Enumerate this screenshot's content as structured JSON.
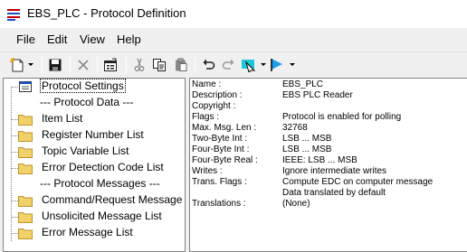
{
  "window": {
    "title": "EBS_PLC - Protocol Definition"
  },
  "menu": [
    "File",
    "Edit",
    "View",
    "Help"
  ],
  "toolbar": {
    "buttons": [
      "new-icon",
      "save-icon",
      "delete-icon",
      "properties-icon",
      "cut-icon",
      "copy-icon",
      "paste-icon",
      "undo-icon",
      "redo-icon",
      "select-icon",
      "flag-icon"
    ]
  },
  "tree": {
    "items": [
      {
        "label": "Protocol Settings",
        "type": "settings",
        "selected": true
      },
      {
        "label": "--- Protocol Data ---",
        "type": "header"
      },
      {
        "label": "Item List",
        "type": "folder"
      },
      {
        "label": "Register Number List",
        "type": "folder"
      },
      {
        "label": "Topic Variable List",
        "type": "folder"
      },
      {
        "label": "Error Detection Code List",
        "type": "folder"
      },
      {
        "label": "--- Protocol Messages ---",
        "type": "header"
      },
      {
        "label": "Command/Request Message",
        "type": "folder"
      },
      {
        "label": "Unsolicited Message List",
        "type": "folder"
      },
      {
        "label": "Error Message List",
        "type": "folder"
      }
    ]
  },
  "details": [
    {
      "key": "Name :",
      "value": "EBS_PLC"
    },
    {
      "key": "Description :",
      "value": "EBS PLC Reader"
    },
    {
      "key": "Copyright :",
      "value": ""
    },
    {
      "key": "Flags :",
      "value": "Protocol is enabled for polling"
    },
    {
      "key": "Max. Msg. Len :",
      "value": "32768"
    },
    {
      "key": "Two-Byte Int :",
      "value": "LSB ... MSB"
    },
    {
      "key": "Four-Byte Int :",
      "value": "LSB ... MSB"
    },
    {
      "key": "Four-Byte Real :",
      "value": "IEEE: LSB ... MSB"
    },
    {
      "key": "Writes :",
      "value": "Ignore intermediate writes"
    },
    {
      "key": "Trans. Flags :",
      "value": "Compute EDC on computer message"
    },
    {
      "key": "",
      "value": "Data translated by default"
    },
    {
      "key": "Translations :",
      "value": "(None)"
    }
  ]
}
